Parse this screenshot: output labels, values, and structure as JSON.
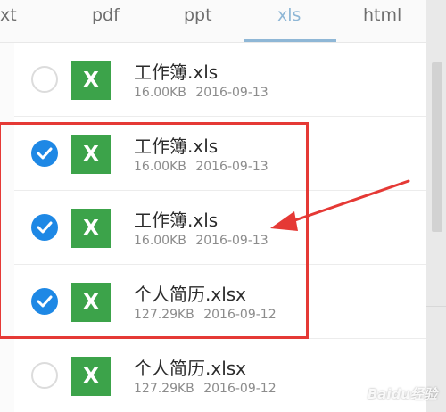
{
  "tabs": [
    {
      "label": "xt",
      "active": false
    },
    {
      "label": "pdf",
      "active": false
    },
    {
      "label": "ppt",
      "active": false
    },
    {
      "label": "xls",
      "active": true
    },
    {
      "label": "html",
      "active": false
    }
  ],
  "files": [
    {
      "name": "工作簿.xls",
      "size": "16.00KB",
      "date": "2016-09-13",
      "checked": false,
      "icon_letter": "X"
    },
    {
      "name": "工作簿.xls",
      "size": "16.00KB",
      "date": "2016-09-13",
      "checked": true,
      "icon_letter": "X"
    },
    {
      "name": "工作簿.xls",
      "size": "16.00KB",
      "date": "2016-09-13",
      "checked": true,
      "icon_letter": "X"
    },
    {
      "name": "个人简历.xlsx",
      "size": "127.29KB",
      "date": "2016-09-12",
      "checked": true,
      "icon_letter": "X"
    },
    {
      "name": "个人简历.xlsx",
      "size": "127.29KB",
      "date": "2016-09-12",
      "checked": false,
      "icon_letter": "X"
    }
  ],
  "colors": {
    "accent": "#8fb7d6",
    "checkbox_checked": "#1e88e5",
    "excel_icon": "#3ca34a",
    "annotation_red": "#e53935"
  },
  "icons": {
    "checkbox_checked": "checkmark-circle-icon",
    "checkbox_unchecked": "empty-circle-icon",
    "file_type": "excel-file-icon"
  },
  "watermark": {
    "text": "Baidu经验"
  }
}
